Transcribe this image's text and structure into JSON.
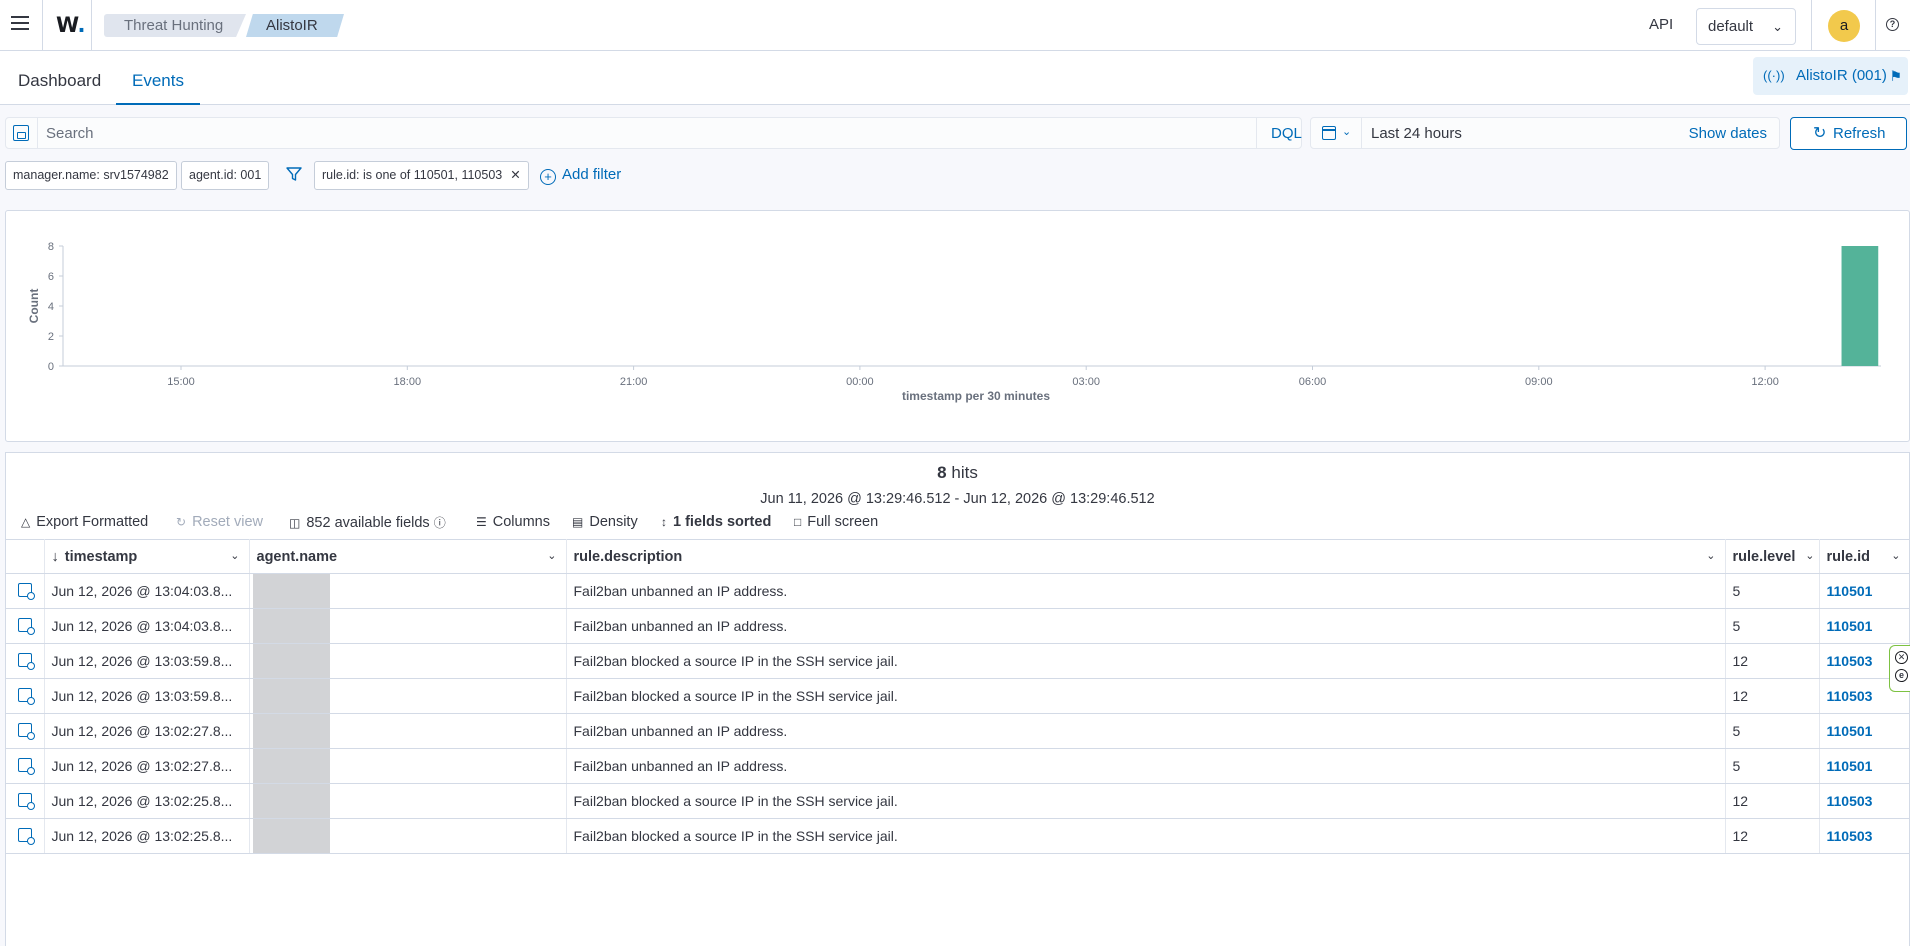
{
  "header": {
    "logo_text": "W",
    "breadcrumbs": [
      "Threat Hunting",
      "AlistoIR"
    ],
    "api_label": "API",
    "space_select": "default",
    "avatar_initial": "a",
    "help_label": "?"
  },
  "tabs": [
    {
      "label": "Dashboard",
      "active": false
    },
    {
      "label": "Events",
      "active": true
    }
  ],
  "pinned_agent": "AlistoIR (001)",
  "search": {
    "placeholder": "Search",
    "value": "",
    "language": "DQL"
  },
  "time": {
    "range_label": "Last 24 hours",
    "show_dates_label": "Show dates",
    "refresh_label": "Refresh"
  },
  "filters": [
    "manager.name: srv1574982",
    "agent.id: 001",
    "rule.id: is one of 110501, 110503"
  ],
  "add_filter_label": "Add filter",
  "chart_data": {
    "type": "bar",
    "title": "",
    "xlabel": "timestamp per 30 minutes",
    "ylabel": "Count",
    "x_ticks": [
      "15:00",
      "18:00",
      "21:00",
      "00:00",
      "03:00",
      "06:00",
      "09:00",
      "12:00"
    ],
    "y_ticks": [
      0,
      2,
      4,
      6,
      8
    ],
    "ylim": [
      0,
      8
    ],
    "bars": [
      {
        "x": "13:00",
        "value": 8
      }
    ],
    "color": "#54b399",
    "grid": false
  },
  "results": {
    "hits_count": "8",
    "hits_label": "hits",
    "range_text": "Jun 11, 2026 @ 13:29:46.512 - Jun 12, 2026 @ 13:29:46.512",
    "toolbar": {
      "export": "Export Formatted",
      "reset": "Reset view",
      "fields": "852 available fields",
      "columns": "Columns",
      "density": "Density",
      "sorted": "1 fields sorted",
      "fullscreen": "Full screen"
    },
    "columns": [
      "timestamp",
      "agent.name",
      "rule.description",
      "rule.level",
      "rule.id"
    ],
    "rows": [
      {
        "timestamp": "Jun 12, 2026 @ 13:04:03.8...",
        "description": "Fail2ban unbanned an IP address.",
        "level": "5",
        "id": "110501"
      },
      {
        "timestamp": "Jun 12, 2026 @ 13:04:03.8...",
        "description": "Fail2ban unbanned an IP address.",
        "level": "5",
        "id": "110501"
      },
      {
        "timestamp": "Jun 12, 2026 @ 13:03:59.8...",
        "description": "Fail2ban blocked a source IP in the SSH service jail.",
        "level": "12",
        "id": "110503"
      },
      {
        "timestamp": "Jun 12, 2026 @ 13:03:59.8...",
        "description": "Fail2ban blocked a source IP in the SSH service jail.",
        "level": "12",
        "id": "110503"
      },
      {
        "timestamp": "Jun 12, 2026 @ 13:02:27.8...",
        "description": "Fail2ban unbanned an IP address.",
        "level": "5",
        "id": "110501"
      },
      {
        "timestamp": "Jun 12, 2026 @ 13:02:27.8...",
        "description": "Fail2ban unbanned an IP address.",
        "level": "5",
        "id": "110501"
      },
      {
        "timestamp": "Jun 12, 2026 @ 13:02:25.8...",
        "description": "Fail2ban blocked a source IP in the SSH service jail.",
        "level": "12",
        "id": "110503"
      },
      {
        "timestamp": "Jun 12, 2026 @ 13:02:25.8...",
        "description": "Fail2ban blocked a source IP in the SSH service jail.",
        "level": "12",
        "id": "110503"
      }
    ]
  }
}
